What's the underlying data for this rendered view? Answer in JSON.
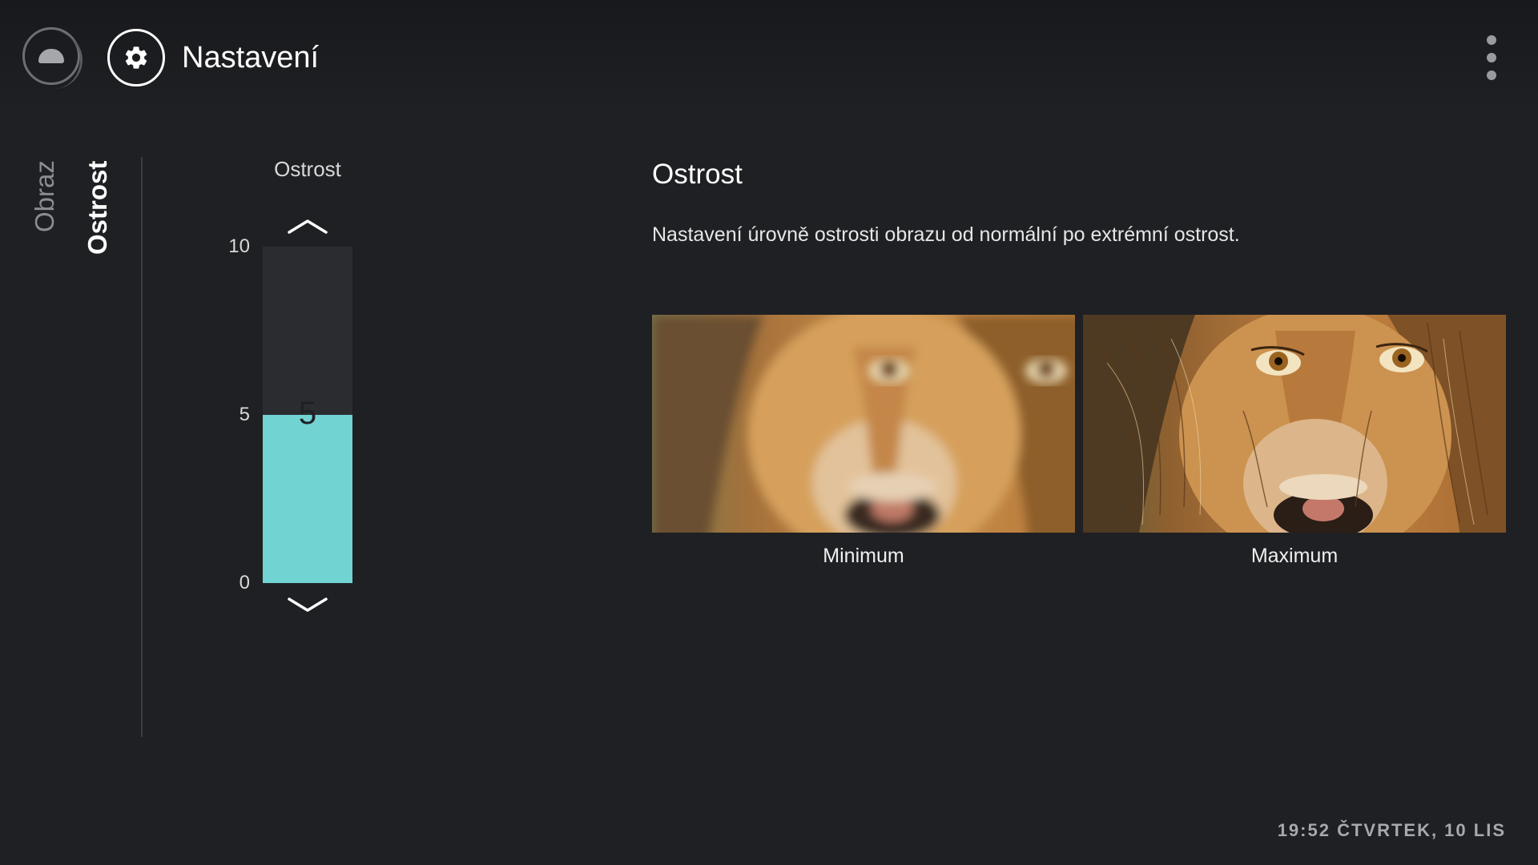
{
  "header": {
    "title": "Nastavení"
  },
  "breadcrumb": {
    "parent": "Obraz",
    "current": "Ostrost"
  },
  "slider": {
    "label": "Ostrost",
    "min": 0,
    "max": 10,
    "value": 5,
    "value_label": "5",
    "ticks": [
      "10",
      "5",
      "0"
    ],
    "fill_color": "#72d3d3"
  },
  "info": {
    "title": "Ostrost",
    "description": "Nastavení úrovně ostrosti obrazu od normální po extrémní ostrost.",
    "previews": [
      {
        "caption": "Minimum"
      },
      {
        "caption": "Maximum"
      }
    ]
  },
  "status": {
    "clock": "19:52 ČTVRTEK, 10 LIS"
  },
  "icons": {
    "home": "home-icon",
    "settings": "gear-icon",
    "more": "more-vert-icon",
    "up": "chevron-up-icon",
    "down": "chevron-down-icon"
  }
}
